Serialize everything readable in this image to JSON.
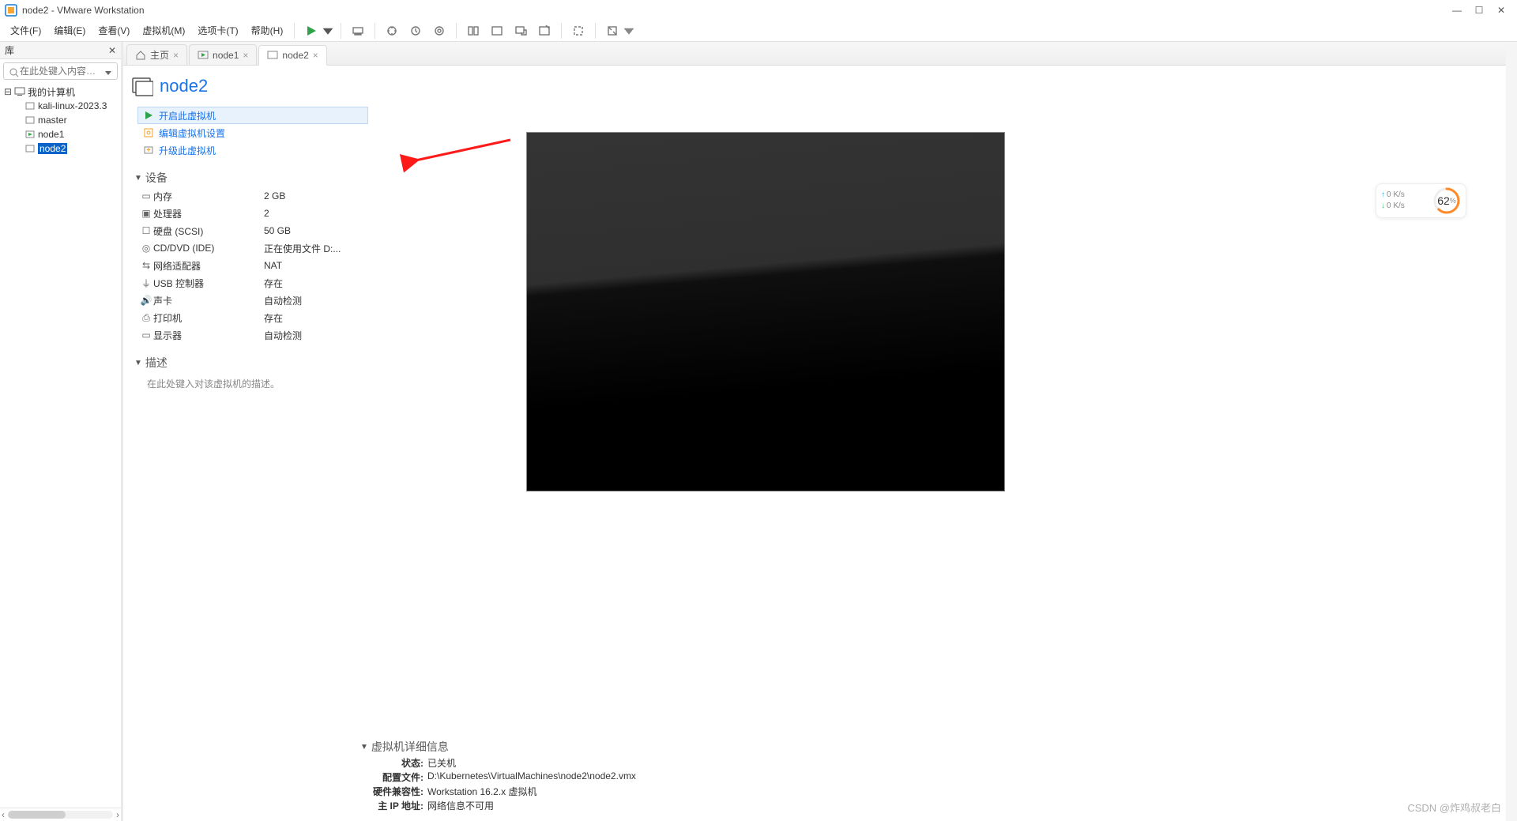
{
  "titlebar": {
    "title": "node2 - VMware Workstation"
  },
  "menubar": {
    "file": "文件(F)",
    "edit": "编辑(E)",
    "view": "查看(V)",
    "vm": "虚拟机(M)",
    "tabs": "选项卡(T)",
    "help": "帮助(H)"
  },
  "sidebar": {
    "title": "库",
    "search_placeholder": "在此处键入内容…",
    "root": "我的计算机",
    "items": [
      "kali-linux-2023.3",
      "master",
      "node1",
      "node2"
    ],
    "selected": "node2"
  },
  "tabs": {
    "home": "主页",
    "t1": "node1",
    "t2": "node2"
  },
  "vm": {
    "name": "node2",
    "actions": {
      "power_on": "开启此虚拟机",
      "edit_settings": "编辑虚拟机设置",
      "upgrade": "升级此虚拟机"
    },
    "devices_header": "设备",
    "devices": [
      {
        "name": "内存",
        "value": "2 GB"
      },
      {
        "name": "处理器",
        "value": "2"
      },
      {
        "name": "硬盘 (SCSI)",
        "value": "50 GB"
      },
      {
        "name": "CD/DVD (IDE)",
        "value": "正在使用文件 D:..."
      },
      {
        "name": "网络适配器",
        "value": "NAT"
      },
      {
        "name": "USB 控制器",
        "value": "存在"
      },
      {
        "name": "声卡",
        "value": "自动检测"
      },
      {
        "name": "打印机",
        "value": "存在"
      },
      {
        "name": "显示器",
        "value": "自动检测"
      }
    ],
    "desc_header": "描述",
    "desc_placeholder": "在此处键入对该虚拟机的描述。",
    "details_header": "虚拟机详细信息",
    "details": {
      "state_k": "状态:",
      "state_v": "已关机",
      "config_k": "配置文件:",
      "config_v": "D:\\Kubernetes\\VirtualMachines\\node2\\node2.vmx",
      "compat_k": "硬件兼容性:",
      "compat_v": "Workstation 16.2.x 虚拟机",
      "ip_k": "主 IP 地址:",
      "ip_v": "网络信息不可用"
    }
  },
  "net_widget": {
    "up": "0  K/s",
    "down": "0  K/s",
    "percent": "62"
  },
  "watermark": "CSDN @炸鸡叔老白"
}
